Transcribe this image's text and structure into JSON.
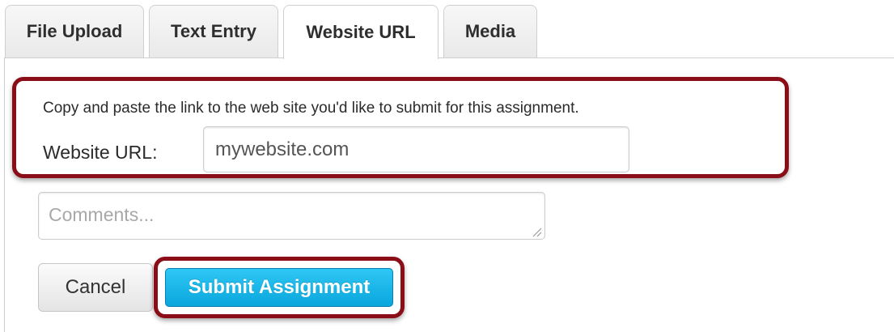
{
  "tabs": [
    {
      "label": "File Upload",
      "active": false
    },
    {
      "label": "Text Entry",
      "active": false
    },
    {
      "label": "Website URL",
      "active": true
    },
    {
      "label": "Media",
      "active": false
    }
  ],
  "url_panel": {
    "instructions": "Copy and paste the link to the web site you'd like to submit for this assignment.",
    "label": "Website URL:",
    "value": "mywebsite.com"
  },
  "comments": {
    "placeholder": "Comments..."
  },
  "buttons": {
    "cancel_label": "Cancel",
    "submit_label": "Submit Assignment"
  },
  "colors": {
    "highlight_border": "#8a0d18",
    "submit_button": "#18b4e8"
  }
}
